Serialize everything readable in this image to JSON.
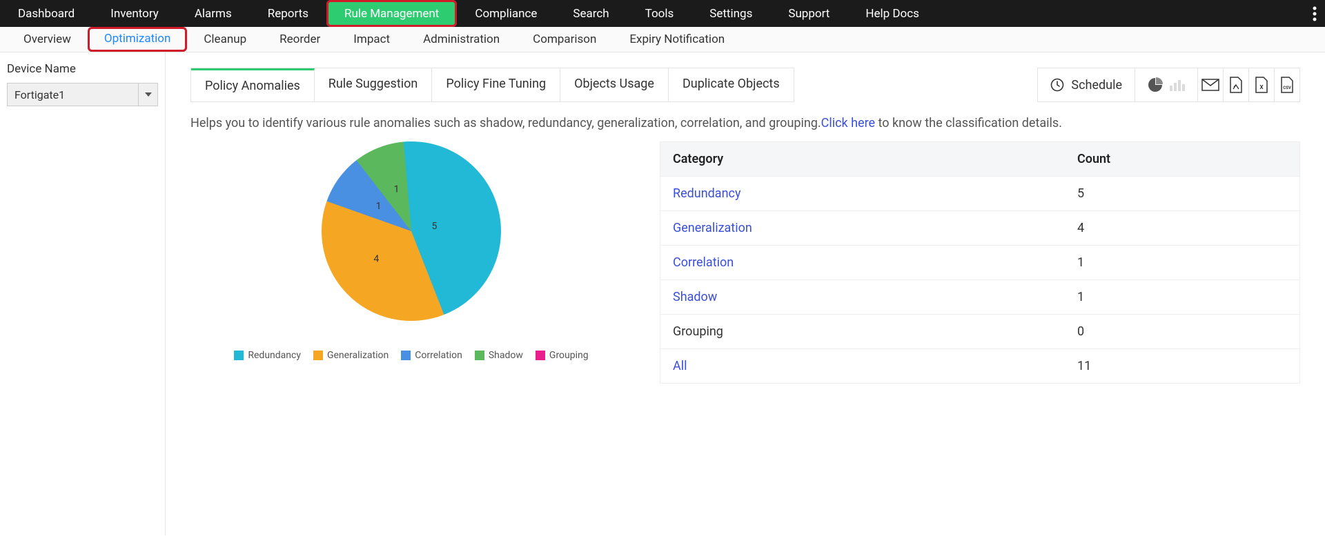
{
  "topnav": {
    "items": [
      "Dashboard",
      "Inventory",
      "Alarms",
      "Reports",
      "Rule Management",
      "Compliance",
      "Search",
      "Tools",
      "Settings",
      "Support",
      "Help Docs"
    ],
    "active_index": 4
  },
  "subnav": {
    "items": [
      "Overview",
      "Optimization",
      "Cleanup",
      "Reorder",
      "Impact",
      "Administration",
      "Comparison",
      "Expiry Notification"
    ],
    "active_index": 1
  },
  "side": {
    "label": "Device Name",
    "selected": "Fortigate1"
  },
  "tabs": {
    "items": [
      "Policy Anomalies",
      "Rule Suggestion",
      "Policy Fine Tuning",
      "Objects Usage",
      "Duplicate Objects"
    ],
    "active_index": 0
  },
  "actions": {
    "schedule": "Schedule"
  },
  "help": {
    "prefix": "Helps you to identify various rule anomalies such as shadow, redundancy, generalization, correlation, and grouping.",
    "link": "Click here",
    "suffix": " to know the classification details."
  },
  "chart_data": {
    "type": "pie",
    "title": "",
    "series": [
      {
        "name": "Redundancy",
        "value": 5,
        "color": "#22b9d6"
      },
      {
        "name": "Generalization",
        "value": 4,
        "color": "#f5a623"
      },
      {
        "name": "Correlation",
        "value": 1,
        "color": "#4a90e2"
      },
      {
        "name": "Shadow",
        "value": 1,
        "color": "#5cb85c"
      },
      {
        "name": "Grouping",
        "value": 0,
        "color": "#e91e8c"
      }
    ]
  },
  "table": {
    "headers": [
      "Category",
      "Count"
    ],
    "rows": [
      {
        "label": "Redundancy",
        "count": 5,
        "link": true
      },
      {
        "label": "Generalization",
        "count": 4,
        "link": true
      },
      {
        "label": "Correlation",
        "count": 1,
        "link": true
      },
      {
        "label": "Shadow",
        "count": 1,
        "link": true
      },
      {
        "label": "Grouping",
        "count": 0,
        "link": false
      },
      {
        "label": "All",
        "count": 11,
        "link": true
      }
    ]
  }
}
